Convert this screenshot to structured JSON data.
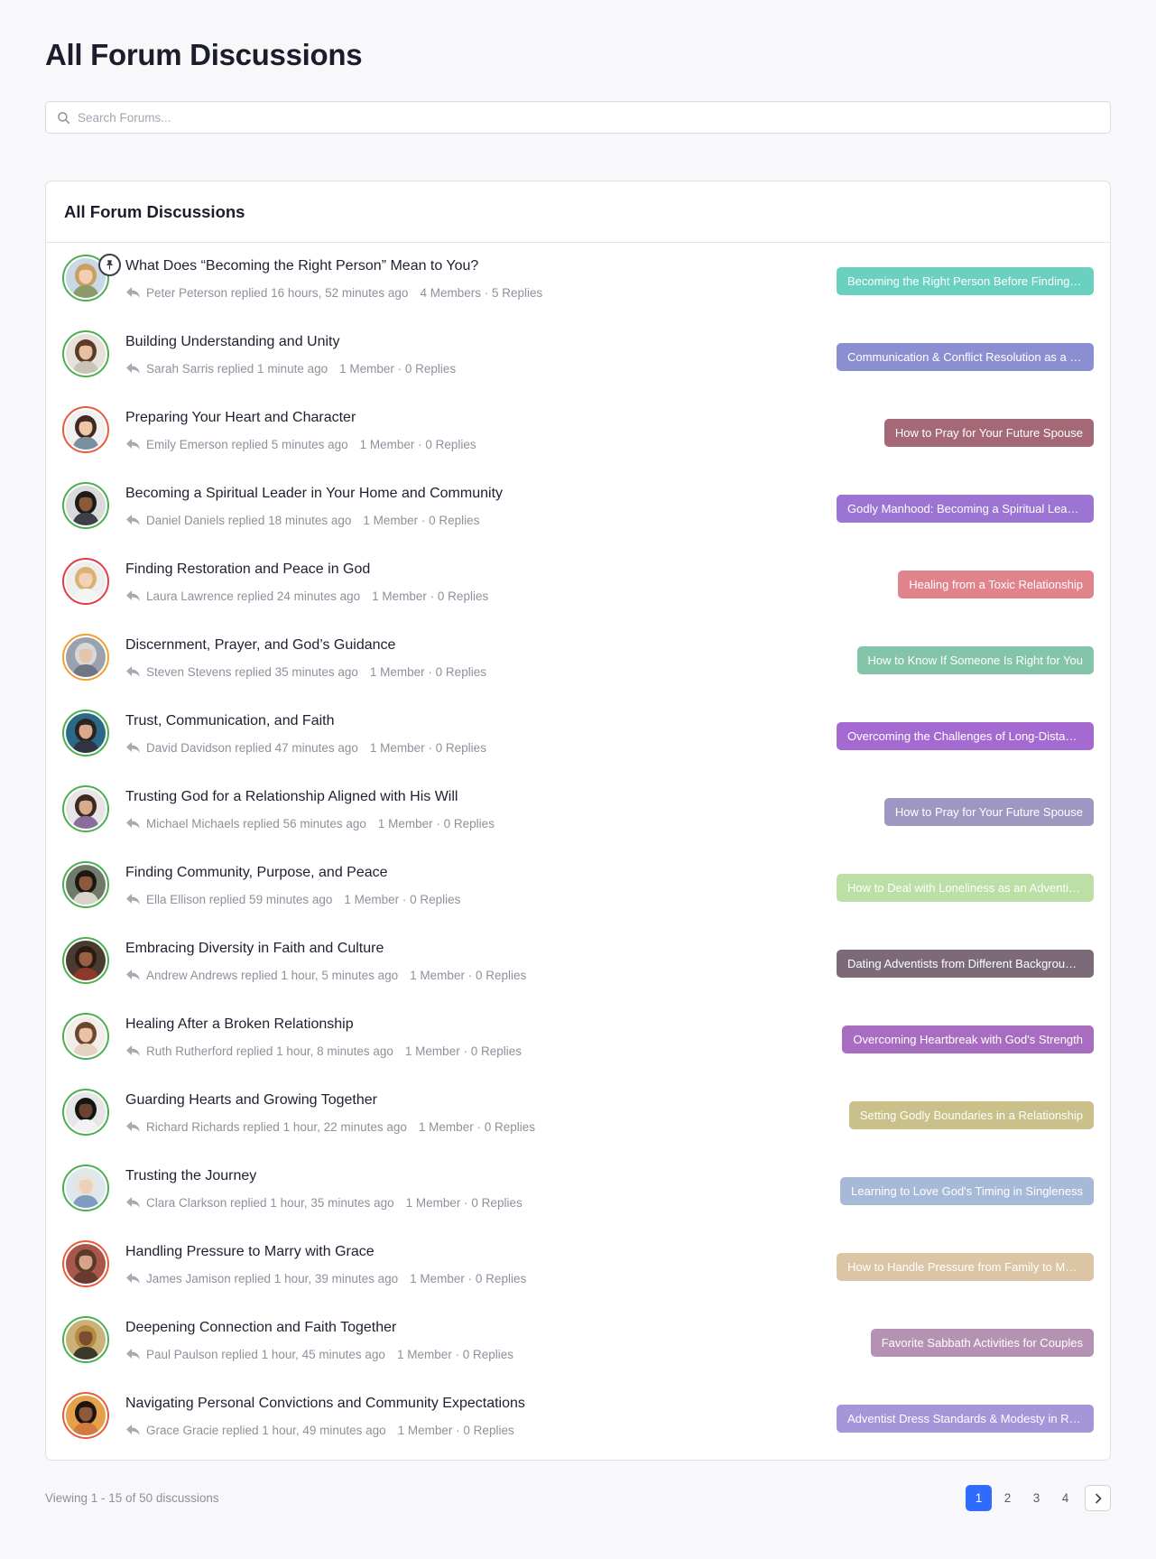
{
  "page": {
    "title": "All Forum Discussions"
  },
  "search": {
    "placeholder": "Search Forums..."
  },
  "card": {
    "title": "All Forum Discussions"
  },
  "discussions": [
    {
      "title": "What Does “Becoming the Right Person” Mean to You?",
      "replied": "Peter Peterson replied 16 hours, 52 minutes ago",
      "counts": "4 Members · 5 Replies",
      "tag": "Becoming the Right Person Before Finding th...",
      "tag_color": "#6ad0bf",
      "ring": "#4caf50",
      "pinned": true,
      "skin": "#f1cfb0",
      "hair": "#c8a060",
      "shirt": "#8a9a6a",
      "bg": "#c9d8e4"
    },
    {
      "title": "Building Understanding and Unity",
      "replied": "Sarah Sarris replied 1 minute ago",
      "counts": "1 Member · 0 Replies",
      "tag": "Communication & Conflict Resolution as a C...",
      "tag_color": "#8b8fd1",
      "ring": "#4caf50",
      "pinned": false,
      "skin": "#e7bfa3",
      "hair": "#5b3a28",
      "shirt": "#c9c2b8",
      "bg": "#e6e1da"
    },
    {
      "title": "Preparing Your Heart and Character",
      "replied": "Emily Emerson replied 5 minutes ago",
      "counts": "1 Member · 0 Replies",
      "tag": "How to Pray for Your Future Spouse",
      "tag_color": "#a46877",
      "ring": "#ea5a3c",
      "pinned": false,
      "skin": "#edc7a8",
      "hair": "#3e2a20",
      "shirt": "#7c8fa1",
      "bg": "#f1f1f1"
    },
    {
      "title": "Becoming a Spiritual Leader in Your Home and Community",
      "replied": "Daniel Daniels replied 18 minutes ago",
      "counts": "1 Member · 0 Replies",
      "tag": "Godly Manhood: Becoming a Spiritual Leader",
      "tag_color": "#9b74d4",
      "ring": "#4caf50",
      "pinned": false,
      "skin": "#8a5a3a",
      "hair": "#1e1a18",
      "shirt": "#3c4048",
      "bg": "#d9dadc"
    },
    {
      "title": "Finding Restoration and Peace in God",
      "replied": "Laura Lawrence replied 24 minutes ago",
      "counts": "1 Member · 0 Replies",
      "tag": "Healing from a Toxic Relationship",
      "tag_color": "#e0838a",
      "ring": "#e53945",
      "pinned": false,
      "skin": "#f2d2b8",
      "hair": "#d9b270",
      "shirt": "#f4f4f4",
      "bg": "#eeeeee"
    },
    {
      "title": "Discernment, Prayer, and God’s Guidance",
      "replied": "Steven Stevens replied 35 minutes ago",
      "counts": "1 Member · 0 Replies",
      "tag": "How to Know If Someone Is Right for You",
      "tag_color": "#84c4a8",
      "ring": "#f0a030",
      "pinned": false,
      "skin": "#e4c4aa",
      "hair": "#d8d8d8",
      "shirt": "#6e7684",
      "bg": "#9aa3ad"
    },
    {
      "title": "Trust, Communication, and Faith",
      "replied": "David Davidson replied 47 minutes ago",
      "counts": "1 Member · 0 Replies",
      "tag": "Overcoming the Challenges of Long-Distanc...",
      "tag_color": "#a56ad2",
      "ring": "#4caf50",
      "pinned": false,
      "skin": "#d9a98a",
      "hair": "#2a2320",
      "shirt": "#2e3440",
      "bg": "#2b6a86"
    },
    {
      "title": "Trusting God for a Relationship Aligned with His Will",
      "replied": "Michael Michaels replied 56 minutes ago",
      "counts": "1 Member · 0 Replies",
      "tag": "How to Pray for Your Future Spouse",
      "tag_color": "#9d98c2",
      "ring": "#4caf50",
      "pinned": false,
      "skin": "#d8ab8b",
      "hair": "#3a2a22",
      "shirt": "#8a6d9a",
      "bg": "#e8e4e8"
    },
    {
      "title": "Finding Community, Purpose, and Peace",
      "replied": "Ella Ellison replied 59 minutes ago",
      "counts": "1 Member · 0 Replies",
      "tag": "How to Deal with Loneliness as an Adventist ...",
      "tag_color": "#bcdfa6",
      "ring": "#4caf50",
      "pinned": false,
      "skin": "#8b5a3c",
      "hair": "#1d1713",
      "shirt": "#d8d4cc",
      "bg": "#6f7a6a"
    },
    {
      "title": "Embracing Diversity in Faith and Culture",
      "replied": "Andrew Andrews replied 1 hour, 5 minutes ago",
      "counts": "1 Member · 0 Replies",
      "tag": "Dating Adventists from Different Backgrounds",
      "tag_color": "#7c6a78",
      "ring": "#4caf50",
      "pinned": false,
      "skin": "#9a6044",
      "hair": "#2a1c14",
      "shirt": "#8b3a2a",
      "bg": "#4a3a30"
    },
    {
      "title": "Healing After a Broken Relationship",
      "replied": "Ruth Rutherford replied 1 hour, 8 minutes ago",
      "counts": "1 Member · 0 Replies",
      "tag": "Overcoming Heartbreak with God's Strength",
      "tag_color": "#a86cc0",
      "ring": "#4caf50",
      "pinned": false,
      "skin": "#e9c2a4",
      "hair": "#6a4630",
      "shirt": "#e6d2c2",
      "bg": "#f3eee9"
    },
    {
      "title": "Guarding Hearts and Growing Together",
      "replied": "Richard Richards replied 1 hour, 22 minutes ago",
      "counts": "1 Member · 0 Replies",
      "tag": "Setting Godly Boundaries in a Relationship",
      "tag_color": "#c9c08a",
      "ring": "#4caf50",
      "pinned": false,
      "skin": "#6b4430",
      "hair": "#141414",
      "shirt": "#f2f2f2",
      "bg": "#e6e6e6"
    },
    {
      "title": "Trusting the Journey",
      "replied": "Clara Clarkson replied 1 hour, 35 minutes ago",
      "counts": "1 Member · 0 Replies",
      "tag": "Learning to Love God's Timing in Singleness",
      "tag_color": "#a6bad8",
      "ring": "#4caf50",
      "pinned": false,
      "skin": "#ecd0b8",
      "hair": "#e8e4dc",
      "shirt": "#7f9bc0",
      "bg": "#dfe7ee"
    },
    {
      "title": "Handling Pressure to Marry with Grace",
      "replied": "James Jamison replied 1 hour, 39 minutes ago",
      "counts": "1 Member · 0 Replies",
      "tag": "How to Handle Pressure from Family to Marry",
      "tag_color": "#dcc5a4",
      "ring": "#ea5a3c",
      "pinned": false,
      "skin": "#d7a488",
      "hair": "#5a3a26",
      "shirt": "#6a3a30",
      "bg": "#a8584a"
    },
    {
      "title": "Deepening Connection and Faith Together",
      "replied": "Paul Paulson replied 1 hour, 45 minutes ago",
      "counts": "1 Member · 0 Replies",
      "tag": "Favorite Sabbath Activities for Couples",
      "tag_color": "#b592b4",
      "ring": "#4caf50",
      "pinned": false,
      "skin": "#7a4c32",
      "hair": "#b88a40",
      "shirt": "#3a3a2c",
      "bg": "#c9b27a"
    },
    {
      "title": "Navigating Personal Convictions and Community Expectations",
      "replied": "Grace Gracie replied 1 hour, 49 minutes ago",
      "counts": "1 Member · 0 Replies",
      "tag": "Adventist Dress Standards & Modesty in Rela...",
      "tag_color": "#a596da",
      "ring": "#ea5a3c",
      "pinned": false,
      "skin": "#8d5a3e",
      "hair": "#1e1510",
      "shirt": "#d27a40",
      "bg": "#e7a04a"
    }
  ],
  "icons": {
    "search": "search-icon",
    "reply": "reply-arrow-icon",
    "pin": "pin-icon",
    "next": "chevron-right-icon"
  },
  "footer": {
    "viewing": "Viewing 1 - 15 of 50 discussions"
  },
  "pagination": {
    "pages": [
      "1",
      "2",
      "3",
      "4"
    ],
    "current": "1"
  },
  "colors": {
    "accent": "#2f6bff",
    "online": "#4caf50",
    "away": "#ea5a3c"
  }
}
